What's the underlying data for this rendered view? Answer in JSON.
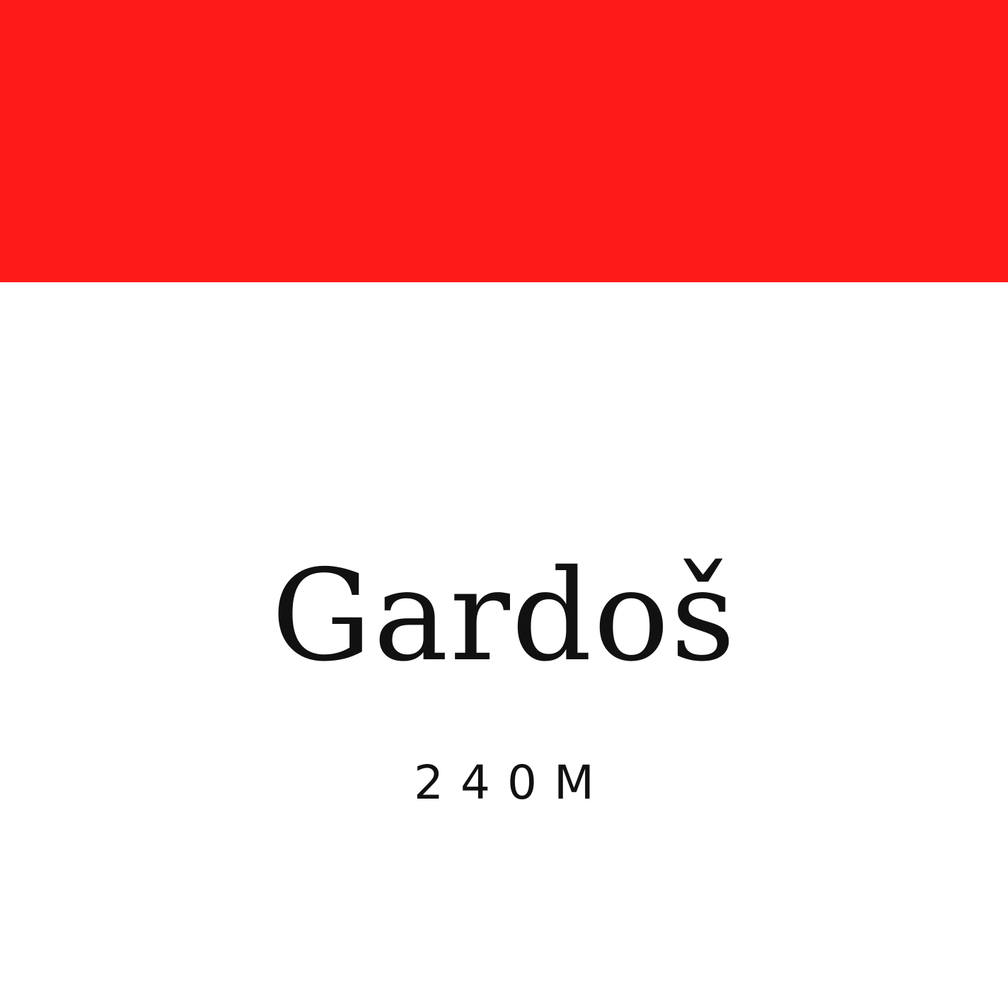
{
  "colors": {
    "band": "#ff1a1a",
    "background": "#ffffff",
    "text": "#111111"
  },
  "title": "Gardoš",
  "elevation": "240M"
}
